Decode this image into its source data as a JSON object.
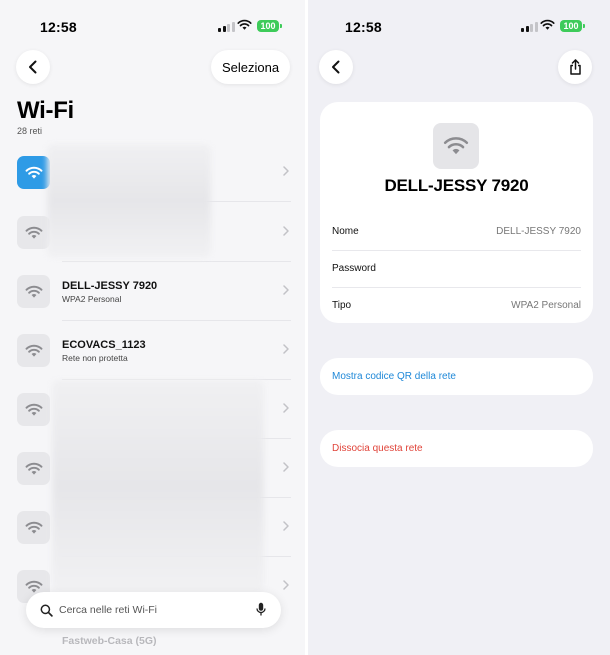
{
  "left": {
    "status": {
      "time": "12:58",
      "battery": "100"
    },
    "header": {
      "back_icon": "chevron-left-icon",
      "select_label": "Seleziona"
    },
    "title": "Wi-Fi",
    "count": "28 reti",
    "networks": [
      {
        "name": "",
        "detail": "",
        "active": true,
        "obscured": true
      },
      {
        "name": "",
        "detail": "",
        "active": false,
        "obscured": true
      },
      {
        "name": "DELL-JESSY 7920",
        "detail": "WPA2 Personal",
        "active": false,
        "obscured": false
      },
      {
        "name": "ECOVACS_1123",
        "detail": "Rete non protetta",
        "active": false,
        "obscured": false
      },
      {
        "name": "",
        "detail": "",
        "active": false,
        "obscured": true
      },
      {
        "name": "",
        "detail": "",
        "active": false,
        "obscured": true
      },
      {
        "name": "",
        "detail": "",
        "active": false,
        "obscured": true
      },
      {
        "name": "",
        "detail": "",
        "active": false,
        "obscured": true
      }
    ],
    "search": {
      "placeholder": "Cerca nelle reti Wi-Fi"
    },
    "partially_hidden_network": "Fastweb-Casa (5G)",
    "colors": {
      "accent": "#2e9be6",
      "battery": "#3ecb5a"
    }
  },
  "right": {
    "status": {
      "time": "12:58",
      "battery": "100"
    },
    "header": {
      "back_icon": "chevron-left-icon",
      "share_icon": "share-icon"
    },
    "network": {
      "ssid": "DELL-JESSY 7920",
      "rows": [
        {
          "label": "Nome",
          "value": "DELL-JESSY 7920"
        },
        {
          "label": "Password",
          "value": ""
        },
        {
          "label": "Tipo",
          "value": "WPA2 Personal"
        }
      ]
    },
    "actions": {
      "show_qr": "Mostra codice QR della rete",
      "forget": "Dissocia questa rete"
    },
    "colors": {
      "link": "#1e88d8",
      "destructive": "#e0443a"
    }
  }
}
